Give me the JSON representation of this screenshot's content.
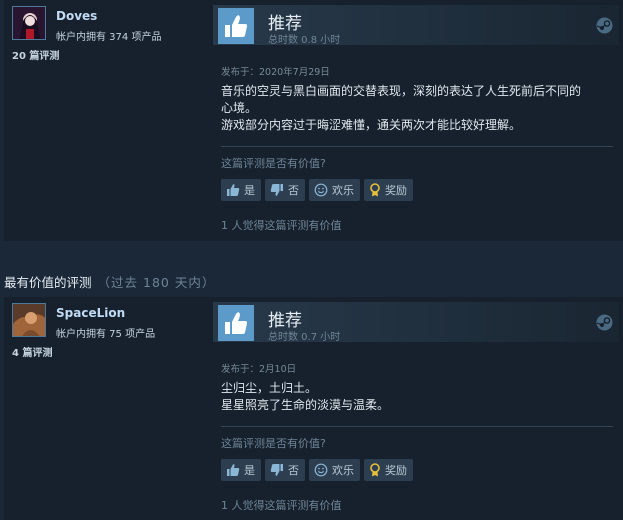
{
  "reviews": [
    {
      "user": {
        "name": "Doves",
        "owned": "帐户内拥有 374 项产品",
        "review_count": "20 篇评测"
      },
      "verdict": "推荐",
      "hours": "总时数 0.8 小时",
      "posted": "发布于：2020年7月29日",
      "body_lines": [
        "音乐的空灵与黑白画面的交替表现，深刻的表达了人生死前后不同的",
        "心境。",
        "游戏部分内容过于晦涩难懂，通关两次才能比较好理解。"
      ],
      "helpful_question": "这篇评测是否有价值?",
      "buttons": {
        "yes": "是",
        "no": "否",
        "funny": "欢乐",
        "award": "奖励"
      },
      "found_helpful": "1 人觉得这篇评测有价值"
    },
    {
      "user": {
        "name": "SpaceLion",
        "owned": "帐户内拥有 75 项产品",
        "review_count": "4 篇评测"
      },
      "verdict": "推荐",
      "hours": "总时数 0.7 小时",
      "posted": "发布于：2月10日",
      "body_lines": [
        "尘归尘，土归土。",
        "星星照亮了生命的淡漠与温柔。"
      ],
      "helpful_question": "这篇评测是否有价值?",
      "buttons": {
        "yes": "是",
        "no": "否",
        "funny": "欢乐",
        "award": "奖励"
      },
      "found_helpful": "1 人觉得这篇评测有价值"
    }
  ],
  "section": {
    "title": "最有价值的评测",
    "range": "（过去 180 天内）"
  },
  "colors": {
    "background": "#1b2838",
    "panel": "#17212d",
    "thumb": "#5c9bc9",
    "username": "#c1dbf4",
    "award": "#e8c03c"
  }
}
